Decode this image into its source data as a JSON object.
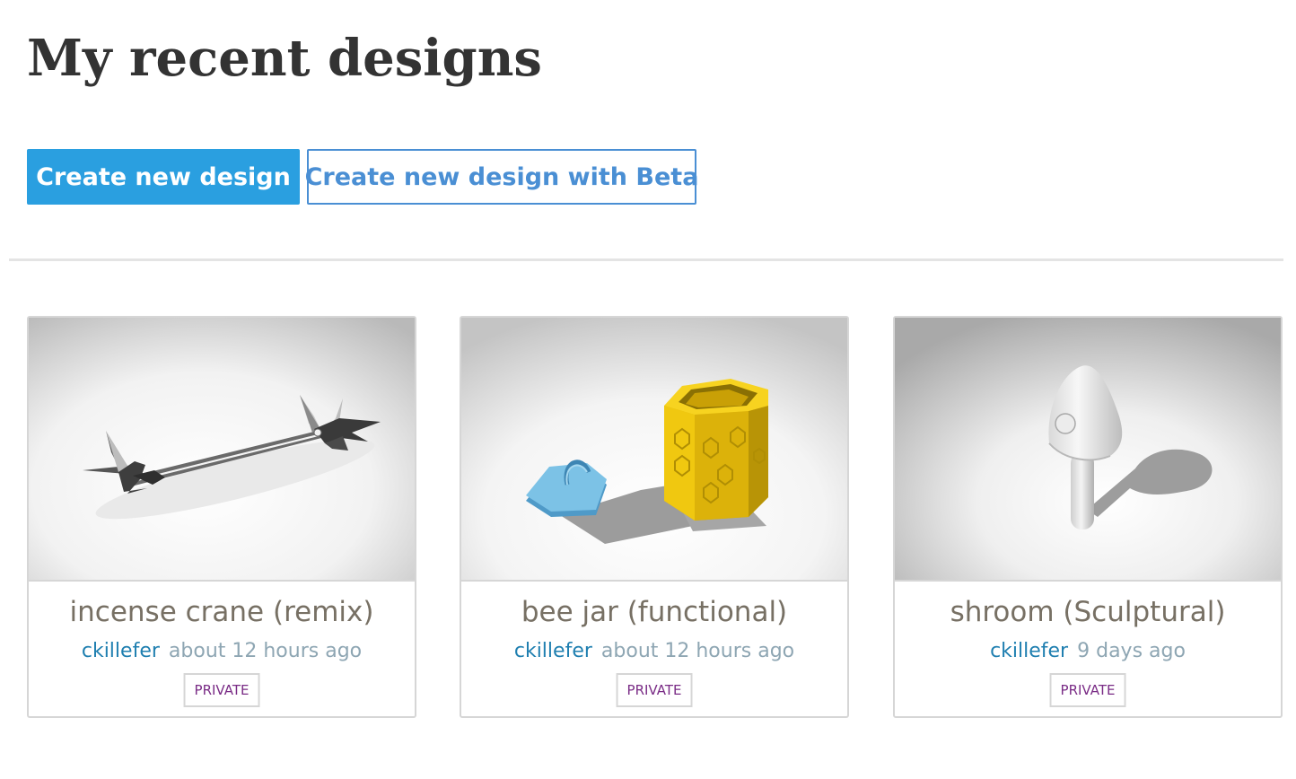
{
  "page": {
    "title": "My recent designs"
  },
  "actions": {
    "create_label": "Create new design",
    "create_beta_label": "Create new design with Beta"
  },
  "designs": [
    {
      "title": "incense crane (remix)",
      "author": "ckillefer",
      "time": "about 12 hours ago",
      "visibility": "PRIVATE"
    },
    {
      "title": "bee jar (functional)",
      "author": "ckillefer",
      "time": "about 12 hours ago",
      "visibility": "PRIVATE"
    },
    {
      "title": "shroom (Sculptural)",
      "author": "ckillefer",
      "time": "9 days ago",
      "visibility": "PRIVATE"
    }
  ],
  "colors": {
    "primary_button": "#2a9fe0",
    "secondary_button_border": "#4a8fd4",
    "author_link": "#1f7fb0",
    "private_badge_text": "#7a2c86",
    "bee_jar_yellow": "#e8c010",
    "bee_jar_lid_blue": "#6fb8df"
  }
}
